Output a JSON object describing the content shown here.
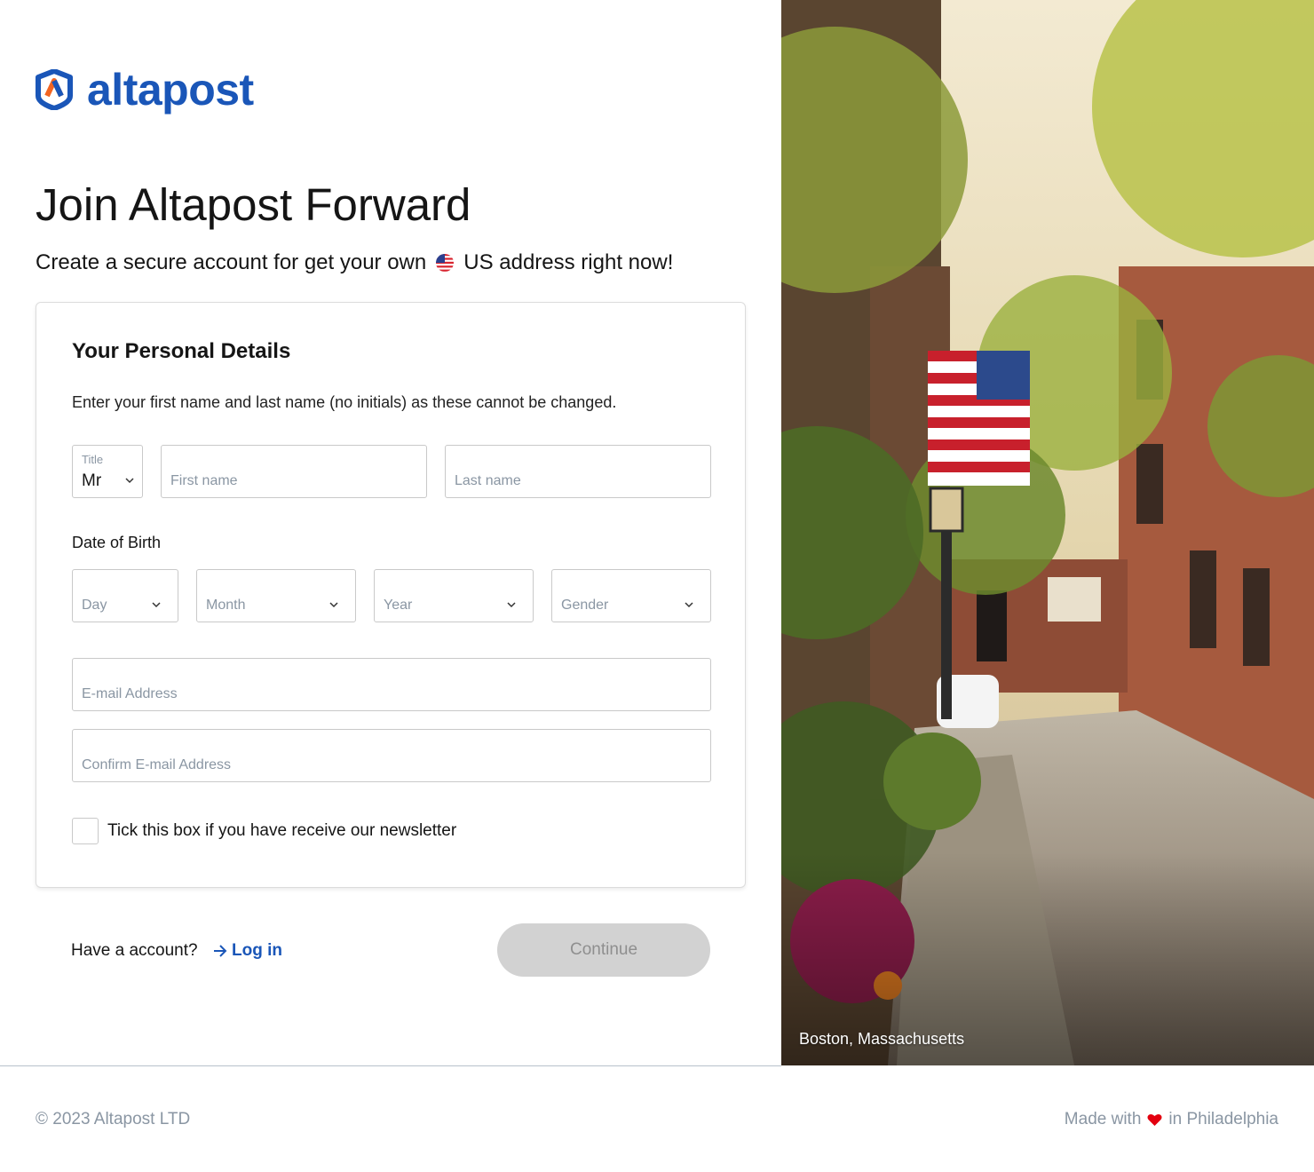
{
  "brand": {
    "name": "altapost",
    "color": "#1a56b8",
    "accent": "#f26522"
  },
  "header": {
    "title": "Join Altapost Forward",
    "subtitle_before": "Create a secure account for get your own",
    "subtitle_flag_icon": "us-flag-icon",
    "subtitle_after": "US address right now!"
  },
  "form": {
    "heading": "Your Personal Details",
    "description": "Enter your first name and last name (no initials) as these cannot be changed.",
    "title_field": {
      "label": "Title",
      "value": "Mr"
    },
    "first_name": {
      "placeholder": "First name",
      "value": ""
    },
    "last_name": {
      "placeholder": "Last name",
      "value": ""
    },
    "dob_label": "Date of Birth",
    "day": {
      "placeholder": "Day"
    },
    "month": {
      "placeholder": "Month"
    },
    "year": {
      "placeholder": "Year"
    },
    "gender": {
      "placeholder": "Gender"
    },
    "email": {
      "placeholder": "E-mail Address",
      "value": ""
    },
    "confirm_email": {
      "placeholder": "Confirm E-mail Address",
      "value": ""
    },
    "newsletter": {
      "label": "Tick this box if you have receive our newsletter",
      "checked": false
    }
  },
  "actions": {
    "have_account": "Have a account?",
    "login_label": "Log in",
    "continue_label": "Continue"
  },
  "photo": {
    "caption": "Boston, Massachusetts"
  },
  "footer": {
    "copyright": "© 2023 Altapost LTD",
    "made_with_before": "Made with",
    "made_with_after": "in Philadelphia",
    "heart_color": "#e3000f"
  }
}
